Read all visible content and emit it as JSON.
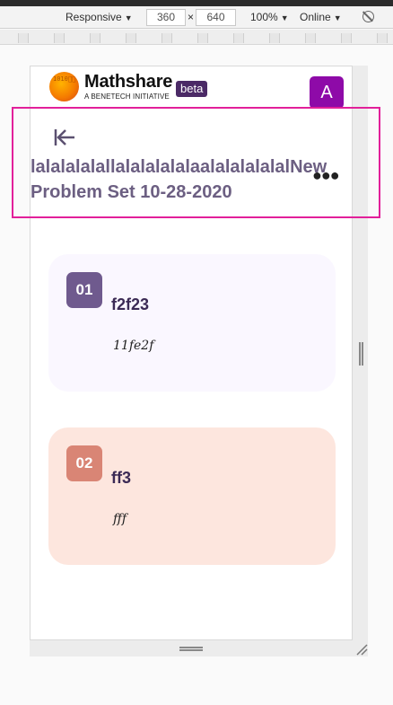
{
  "devtools": {
    "device": "Responsive",
    "width": "360",
    "times": "×",
    "height": "640",
    "zoom": "100%",
    "network": "Online",
    "icons": {
      "rotate": "rotate-icon"
    }
  },
  "header": {
    "brand": "Mathshare",
    "brand_sub": "A BENETECH INITIATIVE",
    "beta": "beta",
    "avatar": "A"
  },
  "problem_set": {
    "title": "lalalalalallalalalalalaalalalalalalNew\nProblem Set 10-28-2020",
    "back_icon": "back-arrow-icon",
    "more_icon": "more-options-icon"
  },
  "problems": [
    {
      "number": "01",
      "title": "f2f23",
      "body": "11fe2f",
      "accent": "#6f5a8e"
    },
    {
      "number": "02",
      "title": "ff3",
      "body": "fff",
      "accent": "#d98575"
    }
  ],
  "colors": {
    "highlight": "#e2209a",
    "avatar": "#8e0aa8",
    "beta": "#4b2a66"
  }
}
